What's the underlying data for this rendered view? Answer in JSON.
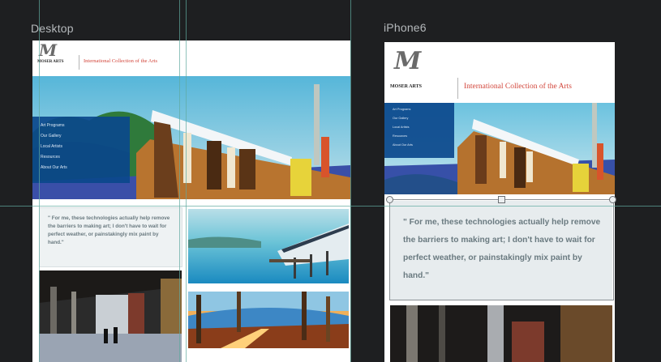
{
  "canvas": {
    "desktop_label": "Desktop",
    "iphone_label": "iPhone6"
  },
  "site": {
    "logo_mark": "M",
    "brand": "MOSER ARTS",
    "tagline": "International Collection of the Arts",
    "nav_items": [
      "Art Programs",
      "Our Gallery",
      "Local Artists",
      "Resources",
      "About Our Arts"
    ],
    "quote_desktop": "\" For me, these technologies actually help remove the barriers to making art; I don't have to wait for perfect weather, or painstakingly mix paint by hand.\"",
    "quote_mobile": "\" For me, these technologies actually help remove the barriers to making art; I don't have to wait for perfect weather, or painstakingly mix paint by hand.\""
  },
  "colors": {
    "canvas_bg": "#1e1f21",
    "nav_bg": "#0b488c",
    "tagline_red": "#d2453a",
    "guide": "#5fa9a0"
  }
}
